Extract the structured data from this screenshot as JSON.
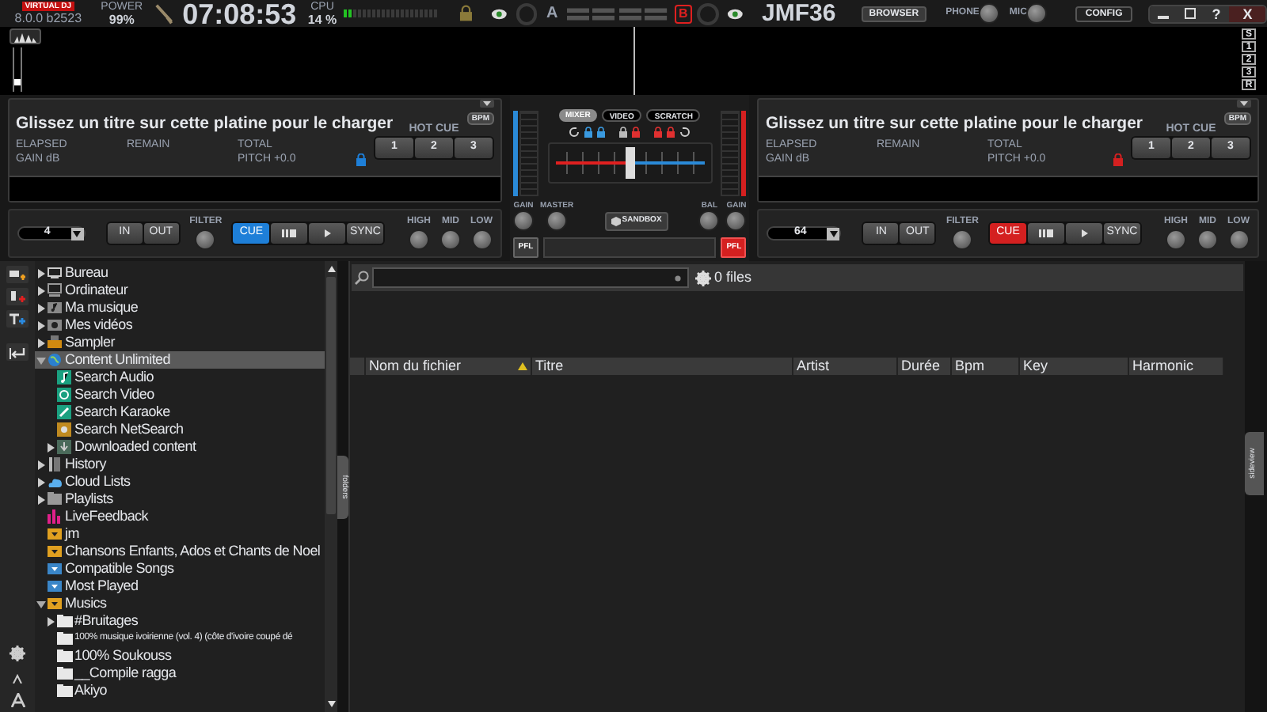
{
  "top_bar": {
    "logo": "VIRTUAL DJ",
    "version": "8.0.0 b2523",
    "power_label": "POWER",
    "power_value": "99%",
    "clock": "07:08:53",
    "cpu_label": "CPU",
    "cpu_value": "14 %",
    "cpu_meter": {
      "level": 0.1
    },
    "deck_a_letter": "A",
    "deck_b_letter": "B",
    "user": "JMF36",
    "browser_button": "BROWSER",
    "phone_label": "PHONE",
    "mic_label": "MIC",
    "config_button": "CONFIG",
    "help_button": "?",
    "close_button": "X"
  },
  "waveform": {
    "zoom_slider": {
      "level": 0.15
    },
    "zoom_buttons": [
      "S",
      "1",
      "2",
      "3",
      "R"
    ]
  },
  "decks": [
    {
      "color": "#1e7fd8",
      "title": "Glissez un titre sur cette platine pour le charger",
      "bpm_button": "BPM",
      "elapsed": "ELAPSED",
      "remain": "REMAIN",
      "total": "TOTAL",
      "gain": "GAIN dB",
      "pitch": "PITCH +0.0",
      "hot_cue_label": "HOT CUE",
      "hot_cues": [
        "1",
        "2",
        "3"
      ],
      "loop_size": "4",
      "loop_in": "IN",
      "loop_out": "OUT",
      "filter": "FILTER",
      "cue": "CUE",
      "sync": "SYNC",
      "eq": [
        "HIGH",
        "MID",
        "LOW"
      ]
    },
    {
      "color": "#d42020",
      "title": "Glissez un titre sur cette platine pour le charger",
      "bpm_button": "BPM",
      "elapsed": "ELAPSED",
      "remain": "REMAIN",
      "total": "TOTAL",
      "gain": "GAIN dB",
      "pitch": "PITCH +0.0",
      "hot_cue_label": "HOT CUE",
      "hot_cues": [
        "1",
        "2",
        "3"
      ],
      "loop_size": "64",
      "loop_in": "IN",
      "loop_out": "OUT",
      "filter": "FILTER",
      "cue": "CUE",
      "sync": "SYNC",
      "eq": [
        "HIGH",
        "MID",
        "LOW"
      ]
    }
  ],
  "mixer": {
    "tabs": [
      {
        "label": "MIXER",
        "selected": true
      },
      {
        "label": "VIDEO",
        "selected": false
      },
      {
        "label": "SCRATCH",
        "selected": false
      }
    ],
    "gain_left": "GAIN",
    "master": "MASTER",
    "sandbox": "SANDBOX",
    "bal": "BAL",
    "gain_right": "GAIN",
    "pfl": [
      {
        "label": "PFL",
        "on": false
      },
      {
        "label": "PFL",
        "on": true
      }
    ]
  },
  "browser": {
    "tree": [
      {
        "label": "Bureau",
        "kind": "desktop",
        "expandable": true,
        "expanded": false,
        "selected": false
      },
      {
        "label": "Ordinateur",
        "kind": "computer",
        "expandable": true,
        "expanded": false,
        "selected": false
      },
      {
        "label": "Ma musique",
        "kind": "music",
        "expandable": true,
        "expanded": false,
        "selected": false
      },
      {
        "label": "Mes vidéos",
        "kind": "video",
        "expandable": true,
        "expanded": false,
        "selected": false
      },
      {
        "label": "Sampler",
        "kind": "sampler",
        "expandable": true,
        "expanded": false,
        "selected": false
      },
      {
        "label": "Content Unlimited",
        "kind": "globe",
        "expandable": true,
        "expanded": true,
        "selected": true,
        "children": [
          {
            "label": "Search Audio",
            "kind": "audio",
            "expandable": false,
            "expanded": false,
            "selected": false
          },
          {
            "label": "Search Video",
            "kind": "videosearch",
            "expandable": false,
            "expanded": false,
            "selected": false
          },
          {
            "label": "Search Karaoke",
            "kind": "karaoke",
            "expandable": false,
            "expanded": false,
            "selected": false
          },
          {
            "label": "Search NetSearch",
            "kind": "netsearch",
            "expandable": false,
            "expanded": false,
            "selected": false
          },
          {
            "label": "Downloaded content",
            "kind": "downloaded",
            "expandable": true,
            "expanded": false,
            "selected": false
          }
        ]
      },
      {
        "label": "History",
        "kind": "history",
        "expandable": true,
        "expanded": false,
        "selected": false
      },
      {
        "label": "Cloud Lists",
        "kind": "cloud",
        "expandable": true,
        "expanded": false,
        "selected": false
      },
      {
        "label": "Playlists",
        "kind": "playlist",
        "expandable": true,
        "expanded": false,
        "selected": false
      },
      {
        "label": "LiveFeedback",
        "kind": "feedback",
        "expandable": false,
        "expanded": false,
        "selected": false
      },
      {
        "label": "jm",
        "kind": "favfolder",
        "expandable": false,
        "expanded": false,
        "selected": false
      },
      {
        "label": "Chansons Enfants, Ados et Chants de Noel",
        "kind": "favfolder",
        "expandable": false,
        "expanded": false,
        "selected": false
      },
      {
        "label": "Compatible Songs",
        "kind": "filter",
        "expandable": false,
        "expanded": false,
        "selected": false
      },
      {
        "label": "Most Played",
        "kind": "filter",
        "expandable": false,
        "expanded": false,
        "selected": false
      },
      {
        "label": "Musics",
        "kind": "favfolder",
        "expandable": true,
        "expanded": true,
        "selected": false,
        "children": [
          {
            "label": "#Bruitages",
            "kind": "folder",
            "expandable": true,
            "expanded": false,
            "selected": false
          },
          {
            "label": "100% musique ivoirienne (vol. 4) (côte d'ivoire coupé dé",
            "kind": "folder",
            "expandable": false,
            "expanded": false,
            "selected": false,
            "small": true
          },
          {
            "label": "100% Soukouss",
            "kind": "folder",
            "expandable": false,
            "expanded": false,
            "selected": false
          },
          {
            "label": "__Compile ragga",
            "kind": "folder",
            "expandable": false,
            "expanded": false,
            "selected": false
          },
          {
            "label": "Akiyo",
            "kind": "folder",
            "expandable": false,
            "expanded": false,
            "selected": false
          }
        ]
      }
    ],
    "folders_tab": "folders",
    "file_count": "0 files",
    "columns": [
      {
        "label": "Nom du fichier",
        "sorted": true
      },
      {
        "label": "Titre",
        "sorted": false
      },
      {
        "label": "Artist",
        "sorted": false
      },
      {
        "label": "Durée",
        "sorted": false
      },
      {
        "label": "Bpm",
        "sorted": false
      },
      {
        "label": "Key",
        "sorted": false
      },
      {
        "label": "Harmonic",
        "sorted": false
      }
    ],
    "sideview_tab": "sideview"
  }
}
